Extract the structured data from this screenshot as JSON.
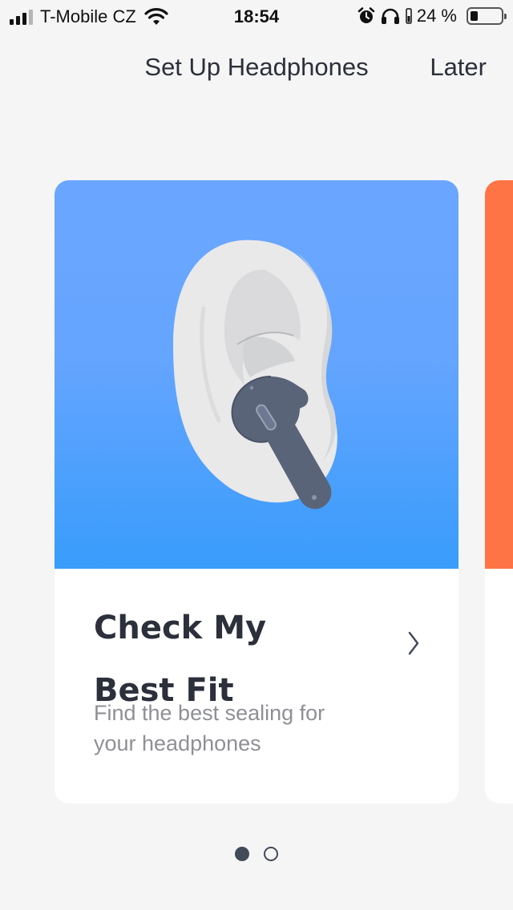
{
  "status_bar": {
    "carrier": "T-Mobile CZ",
    "time": "18:54",
    "battery_percent": "24 %",
    "battery_level": 0.24,
    "icons": [
      "signal-icon",
      "wifi-icon",
      "alarm-icon",
      "headphones-icon",
      "battery-icon"
    ]
  },
  "nav": {
    "title": "Set Up Headphones",
    "later_label": "Later"
  },
  "cards": [
    {
      "title_line1": "Check My",
      "title_line2": "Best Fit",
      "description_line1": "Find the best sealing for",
      "description_line2": "your headphones",
      "image_colors": [
        "#6aa6ff",
        "#399cfb"
      ],
      "icon": "chevron-right-icon"
    },
    {
      "image_color": "#ff7444"
    }
  ],
  "pagination": {
    "total": 2,
    "current": 1
  },
  "colors": {
    "background": "#f5f5f6",
    "text_dark": "#2b303a",
    "text_secondary": "#8f9095",
    "earbud": "#5a6478"
  }
}
